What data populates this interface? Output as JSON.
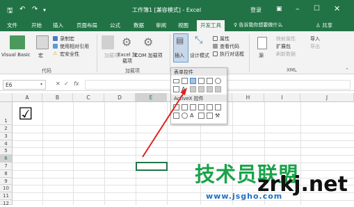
{
  "titlebar": {
    "title": "工作簿1 [兼容模式] - Excel",
    "login": "登录",
    "save_icon": "save-icon",
    "undo_icon": "undo-icon",
    "redo_icon": "redo-icon",
    "customize": "▾"
  },
  "tabs": [
    "文件",
    "开始",
    "插入",
    "页面布局",
    "公式",
    "数据",
    "审阅",
    "视图",
    "开发工具"
  ],
  "tell_me": "告诉我你想要做什么",
  "share": "共享",
  "ribbon": {
    "code": {
      "vba": "Visual Basic",
      "macro": "宏",
      "record": "录制宏",
      "relative": "使用相对引用",
      "security": "宏安全性",
      "label": "代码"
    },
    "addins": {
      "addins": "加载项",
      "excel_addins": "Excel 加载项",
      "com_addins": "COM 加载项",
      "label": "加载项"
    },
    "controls": {
      "insert": "插入",
      "design": "设计模式",
      "properties": "属性",
      "view_code": "查看代码",
      "run_dialog": "执行对话框"
    },
    "xml": {
      "source": "源",
      "map_props": "映射属性",
      "expansion": "扩展包",
      "refresh": "刷新数据",
      "import": "导入",
      "export": "导出",
      "label": "XML"
    }
  },
  "formula_bar": {
    "name_box": "E6",
    "fx": "fx",
    "cancel": "✕",
    "enter": "✓"
  },
  "columns": [
    "A",
    "B",
    "C",
    "D",
    "E",
    "F",
    "G",
    "H",
    "I",
    "J"
  ],
  "rows": [
    "1",
    "2",
    "3",
    "4",
    "5",
    "6",
    "7",
    "8",
    "9",
    "10",
    "11",
    "12"
  ],
  "dropdown": {
    "form_controls": "表单控件",
    "activex": "ActiveX 控件"
  },
  "checkbox_char": "☑",
  "watermark": {
    "cn": "技术员联盟",
    "en": "zrkj.net",
    "url": "www.jsgho.com"
  }
}
